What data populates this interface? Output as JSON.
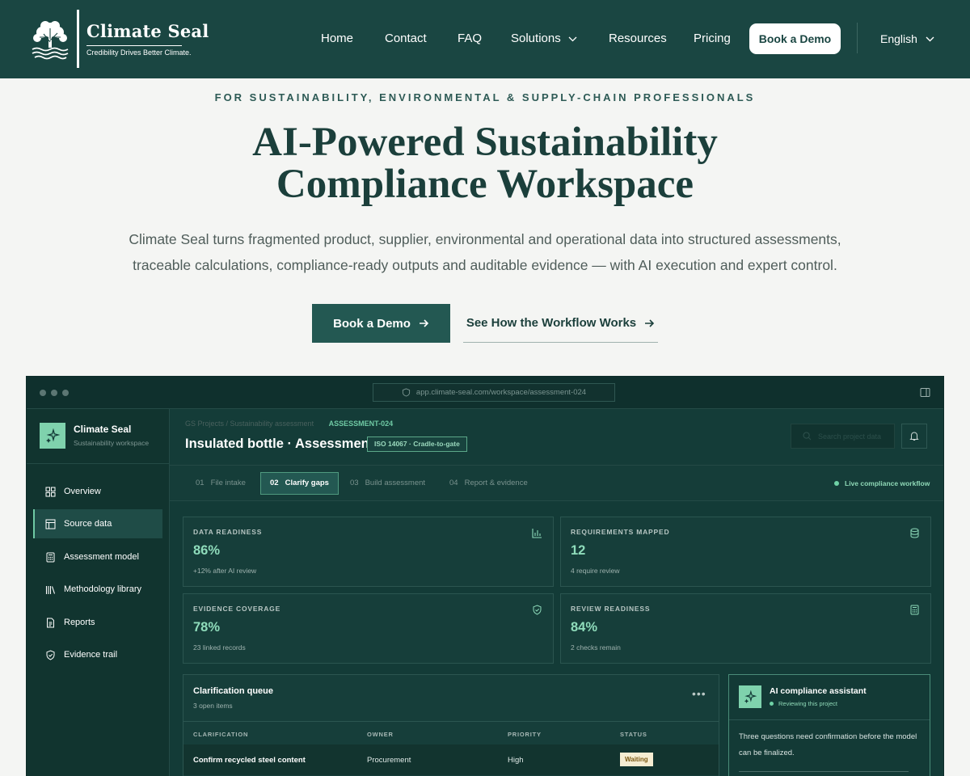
{
  "header": {
    "logo_name": "Climate Seal",
    "logo_tagline": "Credibility Drives Better Climate.",
    "nav": [
      {
        "label": "Home"
      },
      {
        "label": "Contact"
      },
      {
        "label": "FAQ"
      },
      {
        "label": "Solutions"
      },
      {
        "label": "Resources"
      },
      {
        "label": "Pricing"
      }
    ],
    "demo_label": "Book a Demo",
    "language": "English"
  },
  "hero": {
    "eyebrow": "FOR SUSTAINABILITY, ENVIRONMENTAL & SUPPLY-CHAIN PROFESSIONALS",
    "headline_1": "AI-Powered Sustainability",
    "headline_2": "Compliance Workspace",
    "lede_1": "Climate Seal turns fragmented product, supplier, environmental and operational data into structured assessments,",
    "lede_2": "traceable calculations, compliance-ready outputs and auditable evidence — with AI execution and expert control.",
    "cta_primary": "Book a Demo",
    "cta_secondary": "See How the Workflow Works"
  },
  "app": {
    "url": "app.climate-seal.com/workspace/assessment-024",
    "brand_name": "Climate Seal",
    "brand_sub": "Sustainability workspace",
    "sidebar": [
      {
        "label": "Overview",
        "icon": "grid-icon"
      },
      {
        "label": "Source data",
        "icon": "table-icon"
      },
      {
        "label": "Assessment model",
        "icon": "calculator-icon"
      },
      {
        "label": "Methodology library",
        "icon": "library-icon"
      },
      {
        "label": "Reports",
        "icon": "report-icon"
      },
      {
        "label": "Evidence trail",
        "icon": "shield-check-icon"
      }
    ],
    "active_sidebar": "Source data",
    "breadcrumb_parent": "GS Projects / Sustainability assessment",
    "breadcrumb_current": "ASSESSMENT-024",
    "title": "Insulated bottle · Assessment",
    "standard_badge": "ISO 14067 · Cradle-to-gate",
    "search_placeholder": "Search project data",
    "tabs": [
      {
        "num": "01",
        "label": "File intake"
      },
      {
        "num": "02",
        "label": "Clarify gaps"
      },
      {
        "num": "03",
        "label": "Build assessment"
      },
      {
        "num": "04",
        "label": "Report & evidence"
      }
    ],
    "active_tab": "Clarify gaps",
    "live_status": "Live compliance workflow",
    "kpis": [
      {
        "label": "DATA READINESS",
        "value": "86%",
        "note": "+12% after AI review",
        "icon": "bar-chart-icon"
      },
      {
        "label": "REQUIREMENTS MAPPED",
        "value": "12",
        "note": "4 require review",
        "icon": "database-icon"
      },
      {
        "label": "EVIDENCE COVERAGE",
        "value": "78%",
        "note": "23 linked records",
        "icon": "shield-check-icon"
      },
      {
        "label": "REVIEW READINESS",
        "value": "84%",
        "note": "2 checks remain",
        "icon": "calculator-icon"
      }
    ],
    "queue": {
      "title": "Clarification queue",
      "subtitle": "3 open items",
      "columns": [
        "CLARIFICATION",
        "OWNER",
        "PRIORITY",
        "STATUS"
      ],
      "rows": [
        {
          "clarification": "Confirm recycled steel content",
          "owner": "Procurement",
          "priority": "High",
          "status": "Waiting"
        }
      ]
    },
    "assistant": {
      "title": "AI compliance assistant",
      "status": "Reviewing this project",
      "message": "Three questions need confirmation before the model can be finalized."
    }
  },
  "colors": {
    "header_bg": "#1a4642",
    "accent": "#7fd2ad",
    "app_bg": "#133b37",
    "warning_badge": "#f6edd2"
  }
}
